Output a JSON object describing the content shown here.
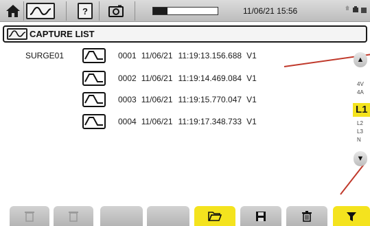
{
  "header": {
    "datetime": "11/06/21 15:56",
    "recording_progress": 0.22
  },
  "title": {
    "label": "CAPTURE LIST"
  },
  "group": {
    "name": "SURGE01"
  },
  "captures": [
    {
      "index": "0001",
      "date": "11/06/21",
      "time": "11:19:13.156.688",
      "channel": "V1"
    },
    {
      "index": "0002",
      "date": "11/06/21",
      "time": "11:19:14.469.084",
      "channel": "V1"
    },
    {
      "index": "0003",
      "date": "11/06/21",
      "time": "11:19:15.770.047",
      "channel": "V1"
    },
    {
      "index": "0004",
      "date": "11/06/21",
      "time": "11:19:17.348.733",
      "channel": "V1"
    }
  ],
  "channels": {
    "above": [
      "4V",
      "4A"
    ],
    "selected": "L1",
    "below": [
      "L2",
      "L3",
      "N"
    ]
  },
  "colors": {
    "accent": "#f4e31e",
    "annotation_line": "#c0392b"
  }
}
